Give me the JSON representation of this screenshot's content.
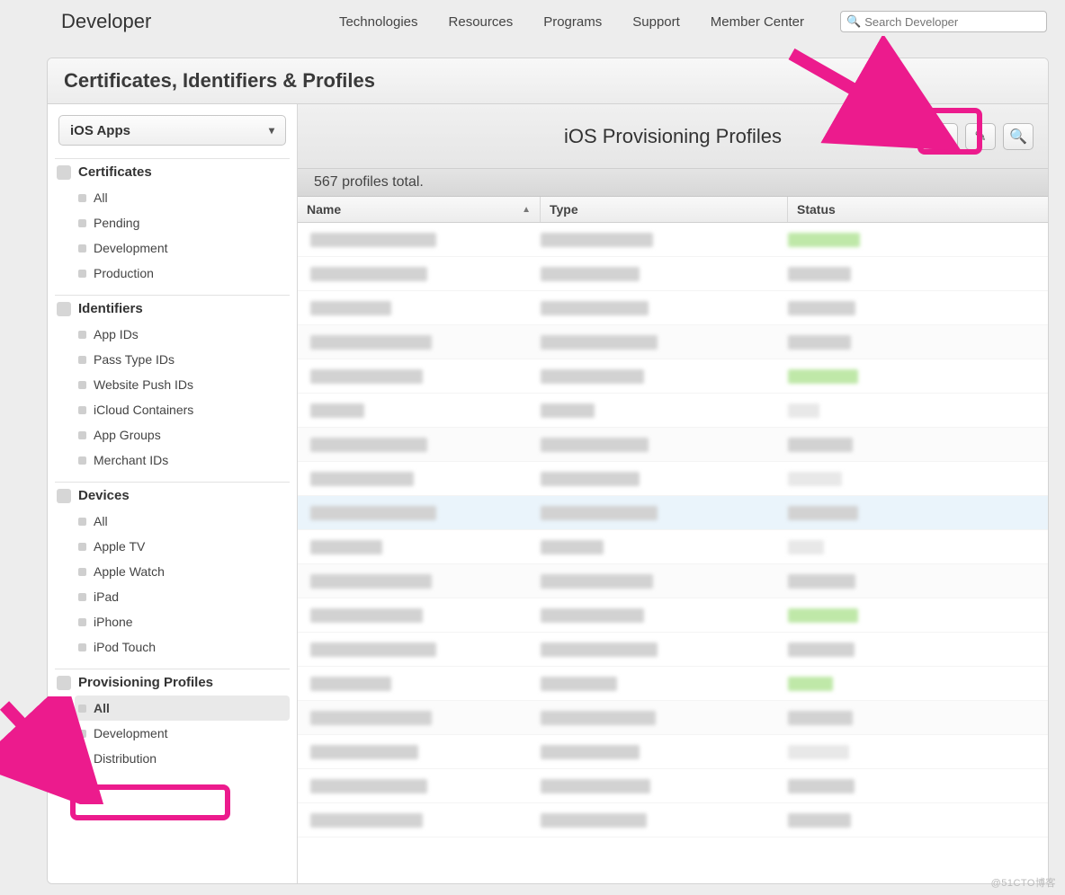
{
  "nav": {
    "brand": "Developer",
    "links": [
      "Technologies",
      "Resources",
      "Programs",
      "Support",
      "Member Center"
    ],
    "search_placeholder": "Search Developer"
  },
  "page_title": "Certificates, Identifiers & Profiles",
  "platform_selector": {
    "label": "iOS Apps"
  },
  "sidebar": {
    "sections": [
      {
        "title": "Certificates",
        "items": [
          "All",
          "Pending",
          "Development",
          "Production"
        ]
      },
      {
        "title": "Identifiers",
        "items": [
          "App IDs",
          "Pass Type IDs",
          "Website Push IDs",
          "iCloud Containers",
          "App Groups",
          "Merchant IDs"
        ]
      },
      {
        "title": "Devices",
        "items": [
          "All",
          "Apple TV",
          "Apple Watch",
          "iPad",
          "iPhone",
          "iPod Touch"
        ]
      },
      {
        "title": "Provisioning Profiles",
        "items": [
          "All",
          "Development",
          "Distribution"
        ],
        "selected": 0
      }
    ]
  },
  "main": {
    "title": "iOS Provisioning Profiles",
    "count_text": "567 profiles total.",
    "columns": {
      "name": "Name",
      "type": "Type",
      "status": "Status"
    },
    "rows": [
      {
        "n": 140,
        "t": 125,
        "s": 80,
        "sc": "green"
      },
      {
        "n": 130,
        "t": 110,
        "s": 70,
        "sc": "grey"
      },
      {
        "n": 90,
        "t": 120,
        "s": 75,
        "sc": "grey"
      },
      {
        "n": 135,
        "t": 130,
        "s": 70,
        "sc": "grey",
        "alt": true
      },
      {
        "n": 125,
        "t": 115,
        "s": 78,
        "sc": "green"
      },
      {
        "n": 60,
        "t": 60,
        "s": 35,
        "sc": "light"
      },
      {
        "n": 130,
        "t": 120,
        "s": 72,
        "sc": "grey",
        "alt": true
      },
      {
        "n": 115,
        "t": 110,
        "s": 60,
        "sc": "light"
      },
      {
        "n": 140,
        "t": 130,
        "s": 78,
        "sc": "grey",
        "hl": true
      },
      {
        "n": 80,
        "t": 70,
        "s": 40,
        "sc": "light"
      },
      {
        "n": 135,
        "t": 125,
        "s": 75,
        "sc": "grey",
        "alt": true
      },
      {
        "n": 125,
        "t": 115,
        "s": 78,
        "sc": "green"
      },
      {
        "n": 140,
        "t": 130,
        "s": 74,
        "sc": "grey"
      },
      {
        "n": 90,
        "t": 85,
        "s": 50,
        "sc": "green"
      },
      {
        "n": 135,
        "t": 128,
        "s": 72,
        "sc": "grey",
        "alt": true
      },
      {
        "n": 120,
        "t": 110,
        "s": 68,
        "sc": "light"
      },
      {
        "n": 130,
        "t": 122,
        "s": 74,
        "sc": "grey"
      },
      {
        "n": 125,
        "t": 118,
        "s": 70,
        "sc": "grey"
      }
    ]
  },
  "watermark": "@51CTO博客"
}
